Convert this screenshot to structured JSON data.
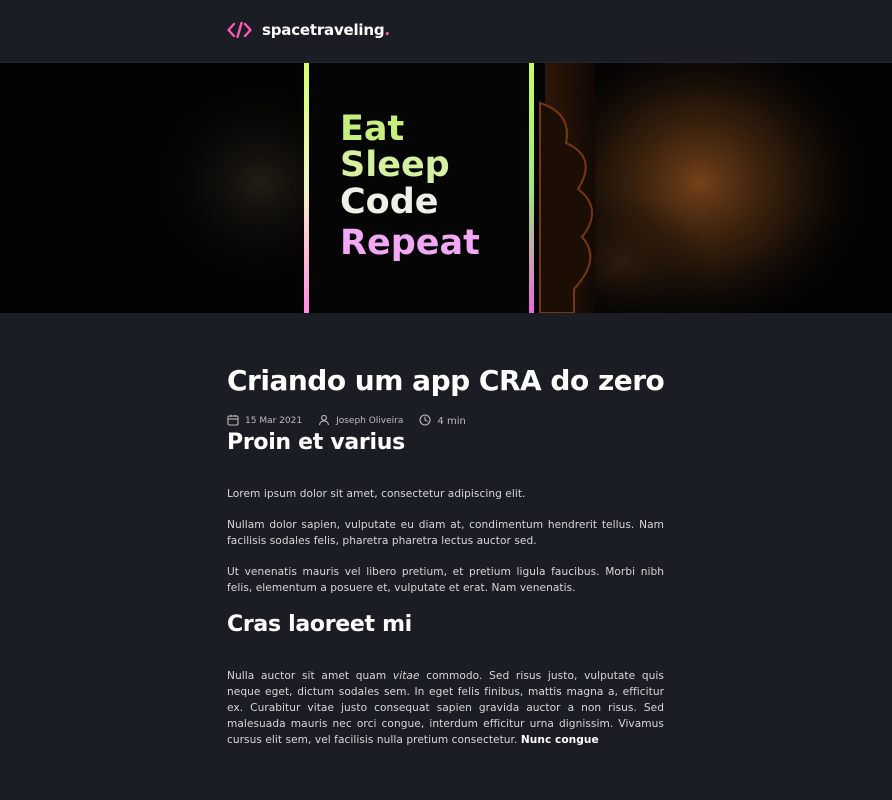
{
  "header": {
    "logo_icon": "code-brackets-icon",
    "logo_text": "spacetraveling",
    "logo_dot": ".",
    "accent": "#ff57b2"
  },
  "banner": {
    "lines": [
      "Eat",
      "Sleep",
      "Code",
      "Repeat"
    ]
  },
  "post": {
    "title": "Criando um app CRA do zero",
    "date": "15 Mar 2021",
    "author": "Joseph Oliveira",
    "reading_time": "4 min",
    "sections": [
      {
        "heading": "Proin et varius",
        "paragraphs": [
          "Lorem ipsum dolor sit amet, consectetur adipiscing elit.",
          "Nullam dolor sapien, vulputate eu diam at, condimentum hendrerit tellus. Nam facilisis sodales felis, pharetra pharetra lectus auctor sed.",
          "Ut venenatis mauris vel libero pretium, et pretium ligula faucibus. Morbi nibh felis, elementum a posuere et, vulputate et erat. Nam venenatis."
        ]
      },
      {
        "heading": "Cras laoreet mi",
        "p1_before": "Nulla auctor sit amet quam ",
        "p1_em": "vitae",
        "p1_after": " commodo. Sed risus justo, vulputate quis neque eget, dictum sodales sem. In eget felis finibus, mattis magna a, efficitur ex. Curabitur vitae justo consequat sapien gravida auctor a non risus. Sed malesuada mauris nec orci congue, interdum efficitur urna dignissim. Vivamus cursus elit sem, vel facilisis nulla pretium consectetur. ",
        "p1_strong": "Nunc congue"
      }
    ]
  }
}
